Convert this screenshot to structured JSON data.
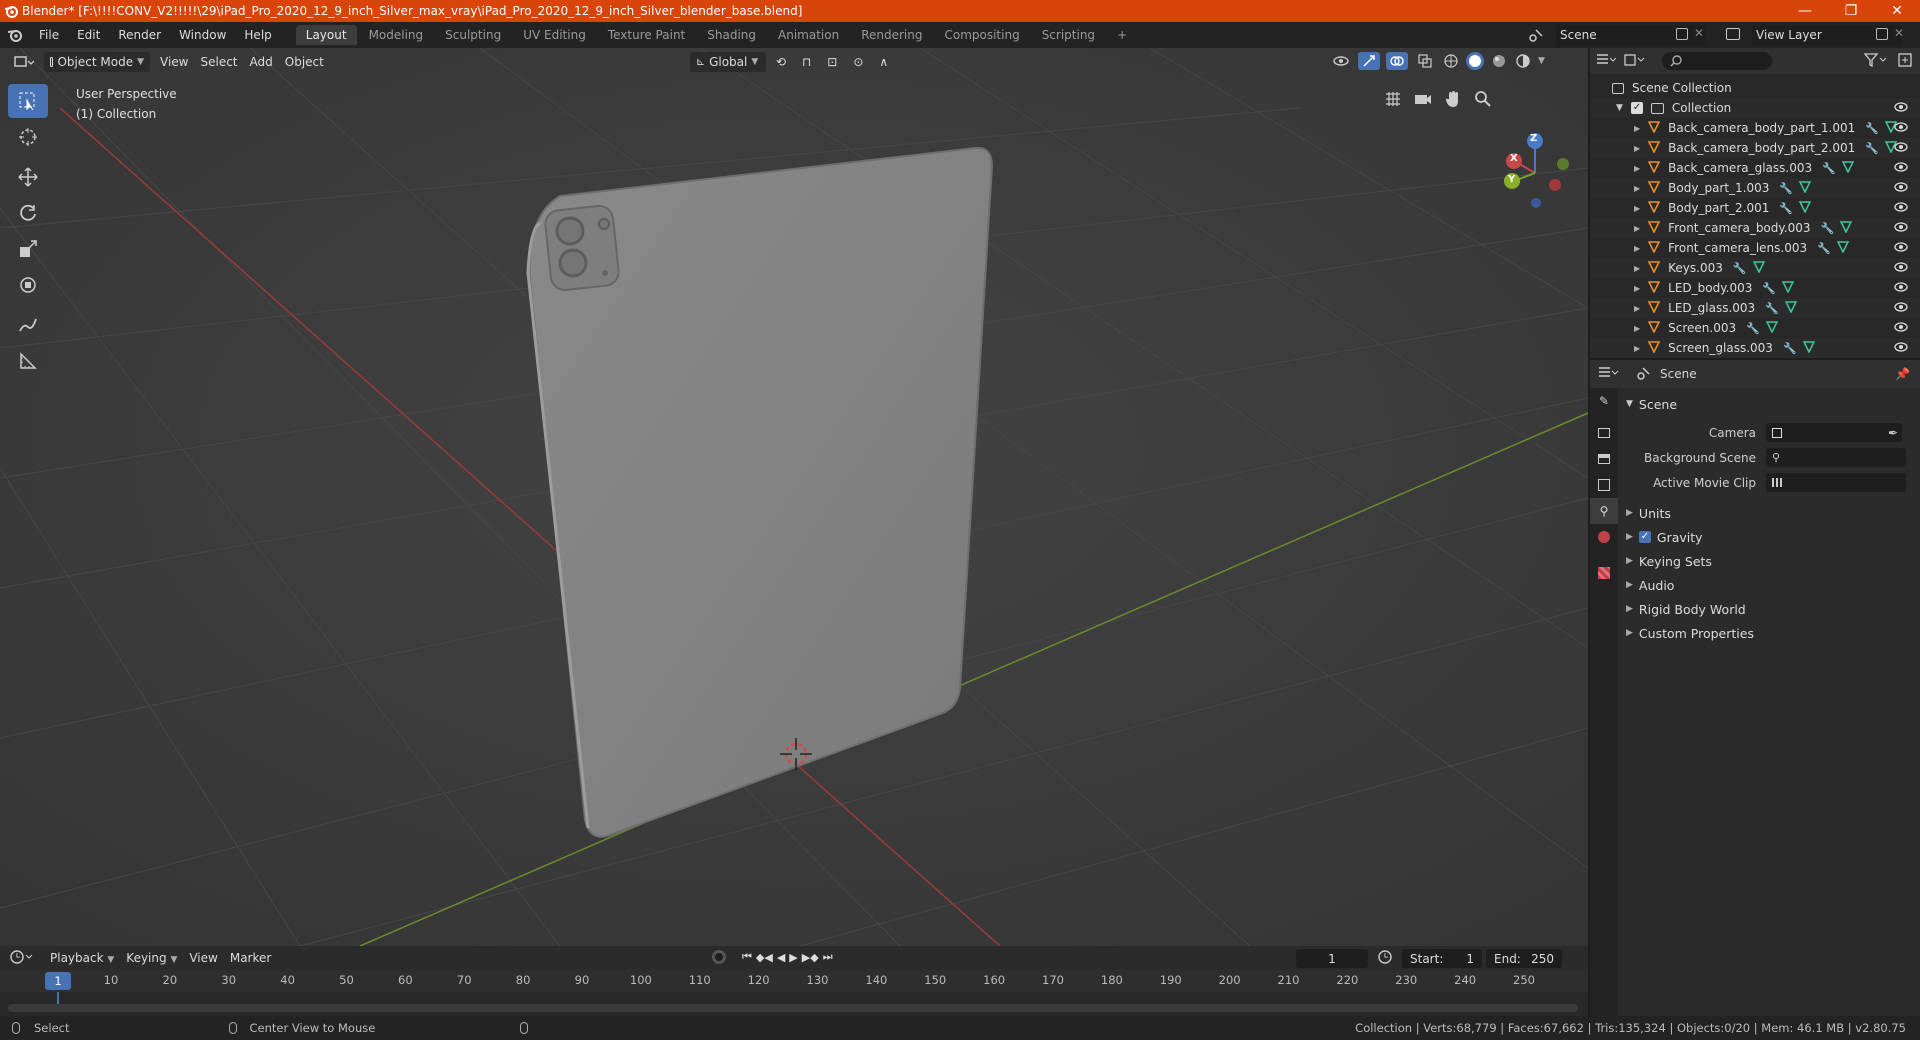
{
  "window": {
    "title": "Blender* [F:\\!!!!CONV_V2!!!!!\\29\\iPad_Pro_2020_12_9_inch_Silver_max_vray\\iPad_Pro_2020_12_9_inch_Silver_blender_base.blend]",
    "minimize": "—",
    "maximize": "❐",
    "close": "✕"
  },
  "menu": [
    "File",
    "Edit",
    "Render",
    "Window",
    "Help"
  ],
  "workspaces": [
    "Layout",
    "Modeling",
    "Sculpting",
    "UV Editing",
    "Texture Paint",
    "Shading",
    "Animation",
    "Rendering",
    "Compositing",
    "Scripting"
  ],
  "workspace_add": "+",
  "scene_selector": "Scene",
  "view_layer_selector": "View Layer",
  "viewport_header": {
    "mode": "Object Mode",
    "menus": [
      "View",
      "Select",
      "Add",
      "Object"
    ],
    "orientation": "Global"
  },
  "viewport": {
    "perspective": "User Perspective",
    "collection": "(1) Collection",
    "gizmo_axes": {
      "x": "X",
      "y": "Y",
      "z": "Z"
    }
  },
  "outliner": {
    "root": "Scene Collection",
    "collection": "Collection",
    "items": [
      "Back_camera_body_part_1.001",
      "Back_camera_body_part_2.001",
      "Back_camera_glass.003",
      "Body_part_1.003",
      "Body_part_2.001",
      "Front_camera_body.003",
      "Front_camera_lens.003",
      "Keys.003",
      "LED_body.003",
      "LED_glass.003",
      "Screen.003",
      "Screen_glass.003"
    ]
  },
  "properties": {
    "context": "Scene",
    "panel": "Scene",
    "fields": [
      {
        "label": "Camera",
        "value": ""
      },
      {
        "label": "Background Scene",
        "value": ""
      },
      {
        "label": "Active Movie Clip",
        "value": ""
      }
    ],
    "subpanels": [
      "Units",
      "Gravity",
      "Keying Sets",
      "Audio",
      "Rigid Body World",
      "Custom Properties"
    ],
    "gravity_checked": true
  },
  "timeline": {
    "menus": [
      "Playback",
      "Keying",
      "View",
      "Marker"
    ],
    "current_frame": "1",
    "start_label": "Start:",
    "start": "1",
    "end_label": "End:",
    "end": "250",
    "ticks": [
      "10",
      "20",
      "30",
      "40",
      "50",
      "60",
      "70",
      "80",
      "90",
      "100",
      "110",
      "120",
      "130",
      "140",
      "150",
      "160",
      "170",
      "180",
      "190",
      "200",
      "210",
      "220",
      "230",
      "240",
      "250"
    ],
    "cursor_label": "1"
  },
  "status": {
    "left": "Select",
    "middle": "Center View to Mouse",
    "right": "Collection | Verts:68,779 | Faces:67,662 | Tris:135,324 | Objects:0/20 | Mem: 46.1 MB | v2.80.75"
  }
}
